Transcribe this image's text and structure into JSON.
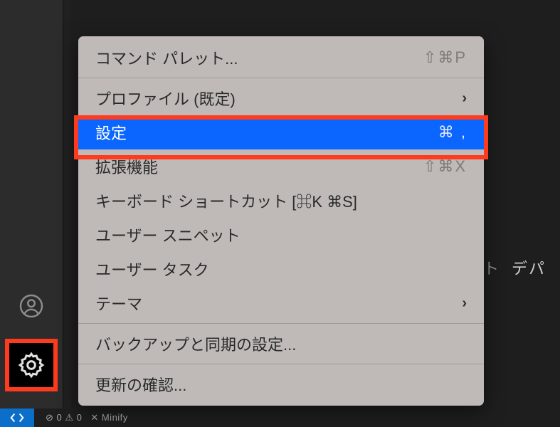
{
  "menu": {
    "items": [
      {
        "label": "コマンド パレット...",
        "shortcut": "⇧⌘P",
        "hasSubmenu": false
      },
      {
        "separator": true
      },
      {
        "label": "プロファイル (既定)",
        "hasSubmenu": true
      },
      {
        "label": "設定",
        "shortcut": "⌘ ,",
        "highlighted": true
      },
      {
        "label": "拡張機能",
        "shortcut": "⇧⌘X"
      },
      {
        "label": "キーボード ショートカット [⌘K ⌘S]"
      },
      {
        "label": "ユーザー スニペット"
      },
      {
        "label": "ユーザー タスク"
      },
      {
        "label": "テーマ",
        "hasSubmenu": true
      },
      {
        "separator": true
      },
      {
        "label": "バックアップと同期の設定..."
      },
      {
        "separator": true
      },
      {
        "label": "更新の確認..."
      }
    ]
  },
  "statusbar": {
    "text1": "⊘ 0 ⚠ 0",
    "text2": "⚠ 0",
    "text3": "✕ Minify"
  },
  "rightPanel": {
    "text1": "ト",
    "text2": "デパ"
  }
}
